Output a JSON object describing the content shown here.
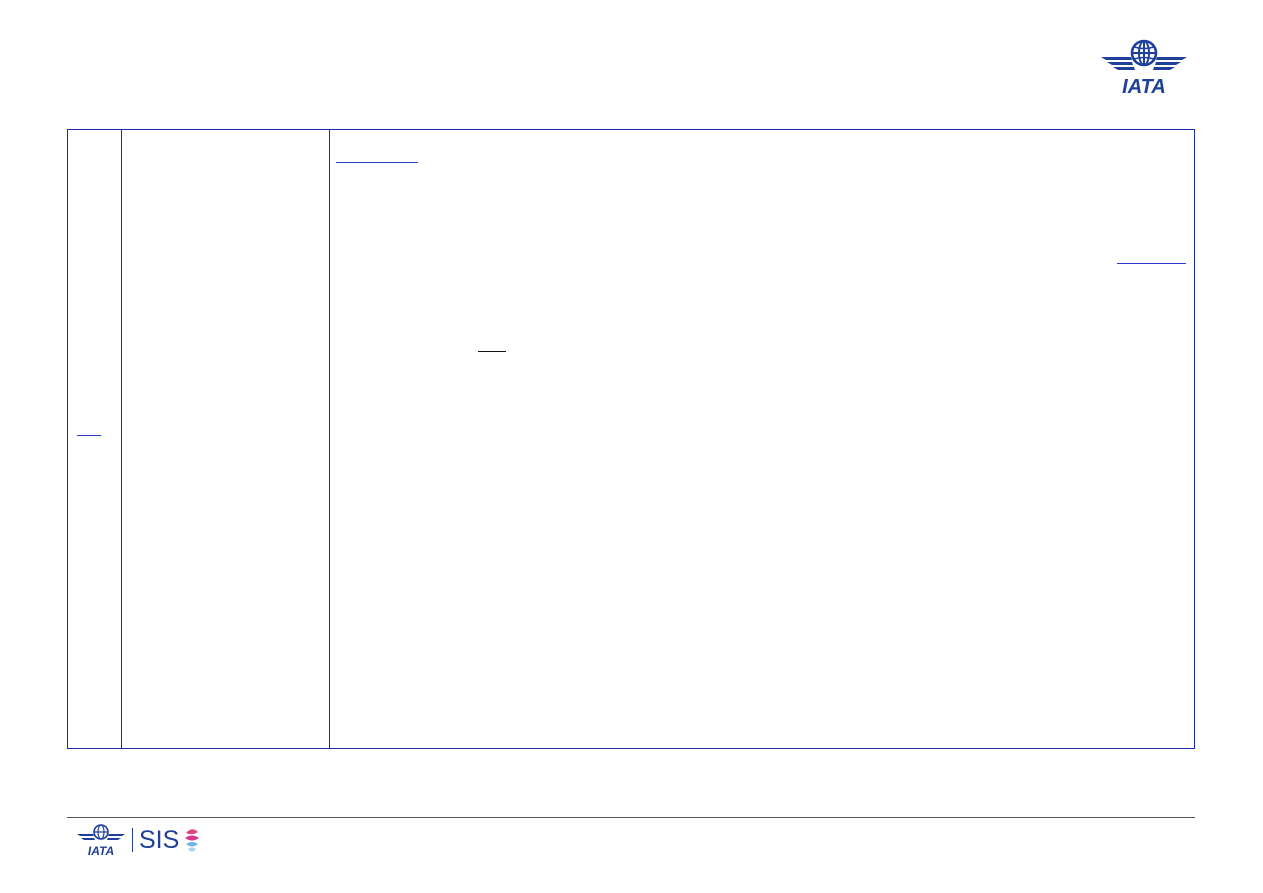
{
  "header": {
    "logo_icon": "iata-globe-wings-logo",
    "logo_text": "IATA"
  },
  "footer": {
    "iata_logo_icon": "iata-globe-wings-logo",
    "iata_logo_text": "IATA",
    "sis_label": "SIS",
    "sis_mark_icon": "sis-swirl-mark"
  },
  "colors": {
    "iata_blue": "#1e3f9a",
    "table_border": "#1c2bb0",
    "link_blue": "#2b3bd0",
    "sis_pink": "#e0457b",
    "sis_light_blue": "#8fc7e8"
  }
}
